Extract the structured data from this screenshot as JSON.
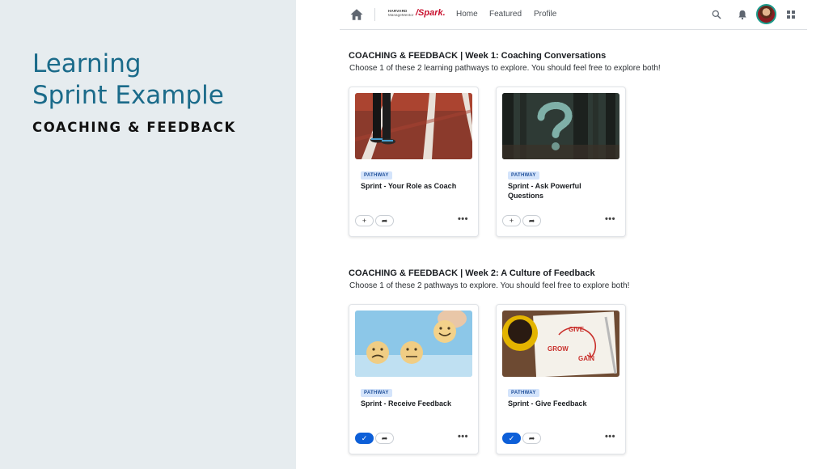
{
  "left_panel": {
    "title_line1": "Learning",
    "title_line2": "Sprint Example",
    "subtitle": "COACHING & FEEDBACK"
  },
  "nav": {
    "brand_line1": "HARVARD",
    "brand_line2": "ManageMentor",
    "brand_spark": "/Spark.",
    "links": [
      "Home",
      "Featured",
      "Profile"
    ],
    "icons": [
      "home-icon",
      "search-icon",
      "bell-icon",
      "avatar",
      "apps-grid-icon"
    ]
  },
  "sections": [
    {
      "title": "COACHING & FEEDBACK  |  Week 1: Coaching Conversations",
      "description": "Choose 1 of these 2 learning pathways to explore. You should feel free to explore both!",
      "cards": [
        {
          "badge": "PATHWAY",
          "title": "Sprint - Your Role as Coach",
          "status": "add",
          "image": "running-track"
        },
        {
          "badge": "PATHWAY",
          "title": "Sprint - Ask Powerful Questions",
          "status": "add",
          "image": "forest-question-mark"
        }
      ]
    },
    {
      "title": "COACHING & FEEDBACK  |  Week 2: A Culture of Feedback",
      "description": "Choose 1 of these 2 pathways to explore. You should feel free to explore both!",
      "cards": [
        {
          "badge": "PATHWAY",
          "title": "Sprint - Receive Feedback",
          "status": "completed",
          "image": "smiley-faces"
        },
        {
          "badge": "PATHWAY",
          "title": "Sprint - Give Feedback",
          "status": "completed",
          "image": "give-grow-gain"
        }
      ]
    }
  ],
  "buttons": {
    "add_glyph": "+",
    "done_glyph": "✓",
    "share_glyph": "➦",
    "more_glyph": "•••"
  },
  "colors": {
    "left_panel_bg": "#e6ecef",
    "title_teal": "#1b6b8a",
    "accent_red": "#c8102e",
    "badge_bg": "#d4e4fb",
    "primary_blue": "#0d5fd8"
  }
}
